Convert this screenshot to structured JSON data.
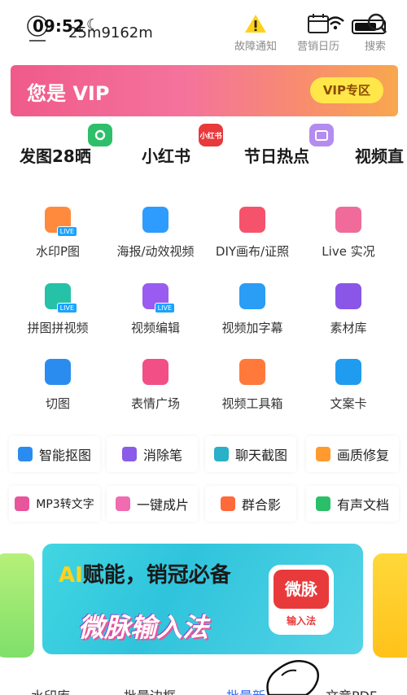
{
  "status": {
    "time": "09:52",
    "user_id": "25m9162m"
  },
  "header": {
    "buttons": [
      {
        "label": "故障通知",
        "icon": "warning-icon"
      },
      {
        "label": "营销日历",
        "icon": "calendar-icon"
      },
      {
        "label": "搜索",
        "icon": "search-icon"
      }
    ]
  },
  "vip": {
    "title": "您是 VIP",
    "button": "VIP专区"
  },
  "tabs": [
    {
      "label": "发图28晒",
      "badge_color": "#2dbf6a"
    },
    {
      "label": "小红书",
      "badge_color": "#e8393c",
      "badge_text": "小红书"
    },
    {
      "label": "节日热点",
      "badge_color": "#b48cf0"
    },
    {
      "label": "视频直"
    }
  ],
  "grid": [
    {
      "label": "水印P图",
      "icon": "photo-watermark-icon",
      "color": "#ff8a3d",
      "live": "LIVE"
    },
    {
      "label": "海报/动效视频",
      "icon": "poster-video-icon",
      "color": "#2e9bff"
    },
    {
      "label": "DIY画布/证照",
      "icon": "canvas-id-photo-icon",
      "color": "#f5536b"
    },
    {
      "label": "Live 实况",
      "icon": "live-photo-icon",
      "color": "#f06b9a"
    },
    {
      "label": "拼图拼视频",
      "icon": "collage-icon",
      "color": "#25c2a8",
      "live": "LIVE"
    },
    {
      "label": "视频编辑",
      "icon": "video-edit-icon",
      "color": "#9a5cf0",
      "live": "LIVE"
    },
    {
      "label": "视频加字幕",
      "icon": "subtitle-mic-icon",
      "color": "#2a9df4"
    },
    {
      "label": "素材库",
      "icon": "layers-icon",
      "color": "#8a56e8"
    },
    {
      "label": "切图",
      "icon": "grid-cut-icon",
      "color": "#2b8cf0"
    },
    {
      "label": "表情广场",
      "icon": "emoji-icon",
      "color": "#f24f86"
    },
    {
      "label": "视频工具箱",
      "icon": "video-toolbox-icon",
      "color": "#ff7a3a"
    },
    {
      "label": "文案卡",
      "icon": "copy-card-icon",
      "color": "#1f9cf0"
    }
  ],
  "chips": [
    {
      "label": "智能抠图",
      "icon": "smart-cutout-icon",
      "color": "#2a8cf0"
    },
    {
      "label": "消除笔",
      "icon": "magic-wand-icon",
      "color": "#8a5ce8"
    },
    {
      "label": "聊天截图",
      "icon": "chat-screenshot-icon",
      "color": "#2ab0c8"
    },
    {
      "label": "画质修复",
      "icon": "hd-icon",
      "color": "#ff9a2e"
    },
    {
      "label": "MP3转文字",
      "icon": "music-note-icon",
      "color": "#e8559a"
    },
    {
      "label": "一键成片",
      "icon": "play-icon",
      "color": "#f06bb0"
    },
    {
      "label": "群合影",
      "icon": "group-photo-icon",
      "color": "#ff6a3a"
    },
    {
      "label": "有声文档",
      "icon": "mic-icon",
      "color": "#2cbf6a"
    }
  ],
  "banner": {
    "headline_ai": "AI",
    "headline_rest": "赋能，销冠必备",
    "subtitle": "微脉输入法",
    "logo_top": "微脉",
    "logo_bottom": "输入法"
  },
  "bottom_labels": [
    "水印库",
    "批量边框",
    "批量新",
    "文章PDF"
  ]
}
